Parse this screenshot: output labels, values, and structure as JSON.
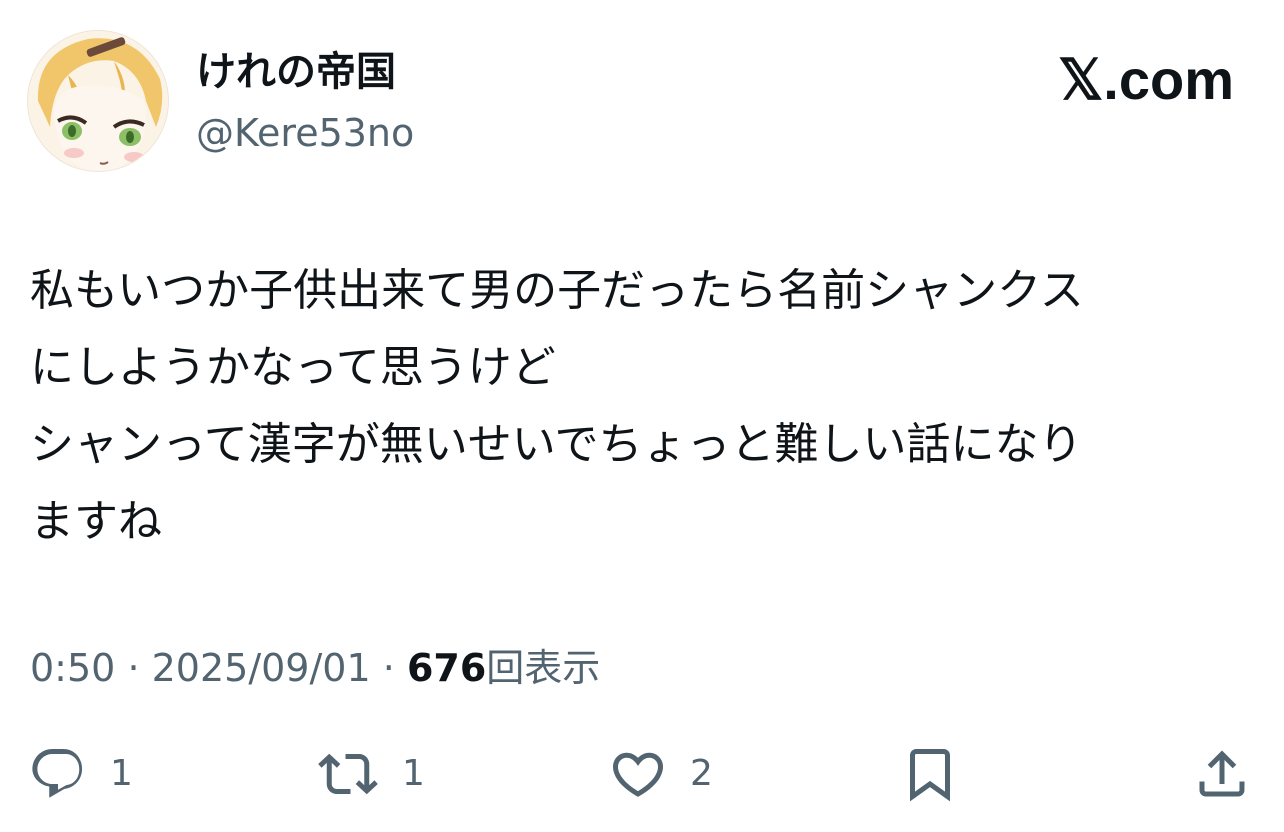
{
  "author": {
    "display_name": "けれの帝国",
    "handle": "@Kere53no",
    "avatar_icon": "anime-character-avatar"
  },
  "brand": {
    "label": "𝕏.com",
    "icon": "x-logo-icon"
  },
  "tweet": {
    "lines": [
      "私もいつか子供出来て男の子だったら名前シャンクス",
      "にしようかなって思うけど",
      "シャンって漢字が無いせいでちょっと難しい話になり",
      "ますね"
    ]
  },
  "meta": {
    "time": "0:50",
    "separator": "·",
    "date": "2025/09/01",
    "views_count": "676",
    "views_label": "回表示"
  },
  "actions": {
    "reply_count": "1",
    "repost_count": "1",
    "like_count": "2"
  },
  "colors": {
    "text_primary": "#0f1419",
    "text_secondary": "#536471"
  }
}
